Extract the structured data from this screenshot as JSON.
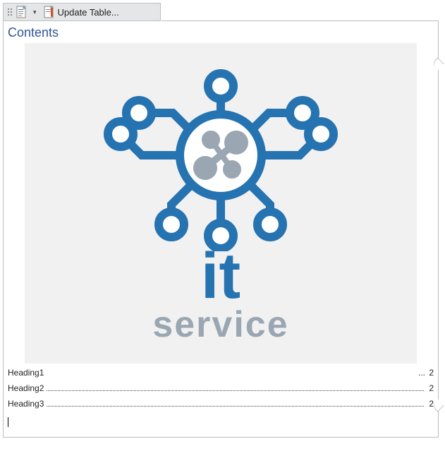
{
  "toolbar": {
    "update_label": "Update Table..."
  },
  "doc": {
    "contents_title": "Contents",
    "logo": {
      "it": "it",
      "service": "service"
    },
    "toc": [
      {
        "label": "Heading1",
        "ellipsis": "...",
        "page": "2",
        "dots": false
      },
      {
        "label": "Heading2",
        "ellipsis": "",
        "page": "2",
        "dots": true
      },
      {
        "label": "Heading3",
        "ellipsis": "",
        "page": "2",
        "dots": true
      }
    ]
  }
}
